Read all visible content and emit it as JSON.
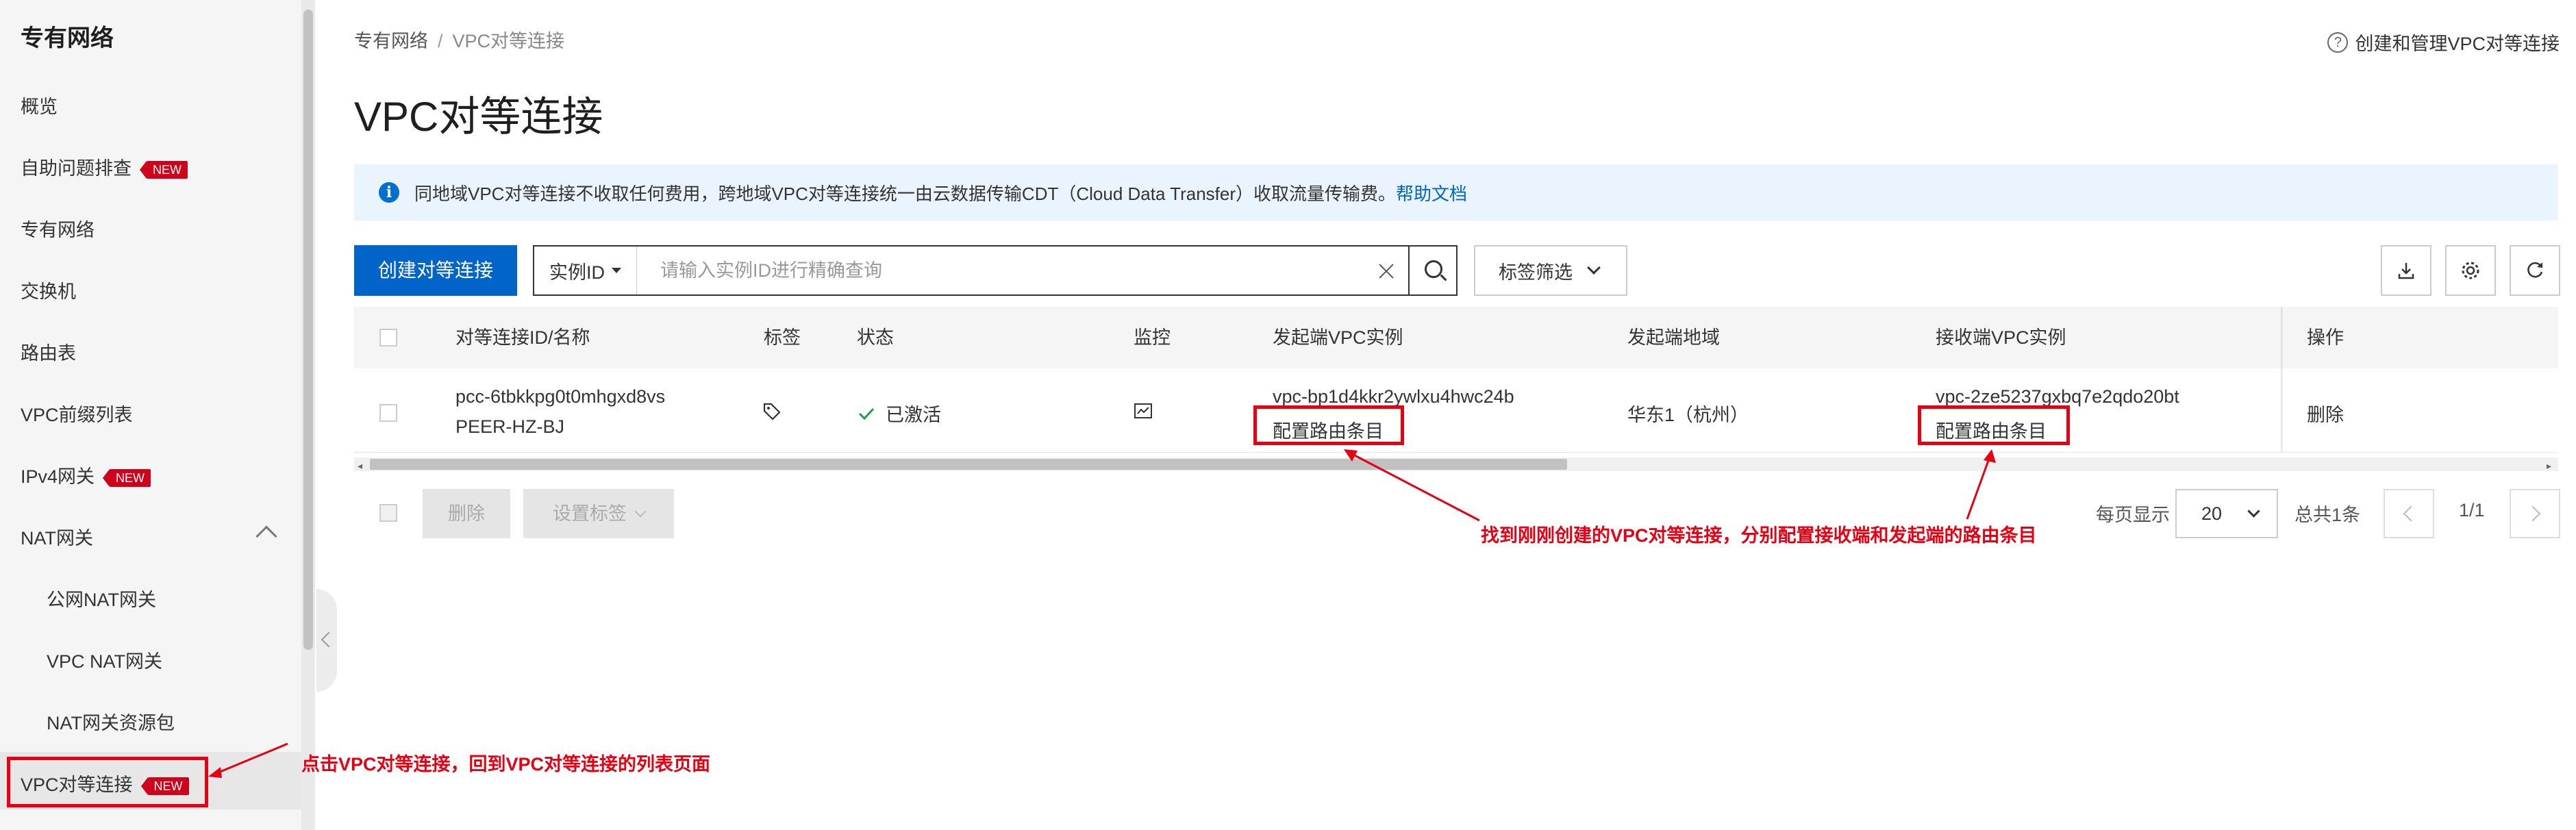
{
  "sidebar": {
    "title": "专有网络",
    "items": [
      {
        "label": "概览"
      },
      {
        "label": "自助问题排查",
        "badge": "NEW"
      },
      {
        "label": "专有网络"
      },
      {
        "label": "交换机"
      },
      {
        "label": "路由表"
      },
      {
        "label": "VPC前缀列表"
      },
      {
        "label": "IPv4网关",
        "badge": "NEW"
      },
      {
        "label": "NAT网关"
      },
      {
        "label": "公网NAT网关"
      },
      {
        "label": "VPC NAT网关"
      },
      {
        "label": "NAT网关资源包"
      },
      {
        "label": "VPC对等连接",
        "badge": "NEW"
      }
    ]
  },
  "breadcrumb": {
    "root": "专有网络",
    "separator": "/",
    "current": "VPC对等连接"
  },
  "help_link": "创建和管理VPC对等连接",
  "page_title": "VPC对等连接",
  "notice": {
    "text": "同地域VPC对等连接不收取任何费用，跨地域VPC对等连接统一由云数据传输CDT（Cloud Data Transfer）收取流量传输费。",
    "link": "帮助文档"
  },
  "toolbar": {
    "create_button": "创建对等连接",
    "search_field": "实例ID",
    "search_placeholder": "请输入实例ID进行精确查询",
    "tag_filter": "标签筛选"
  },
  "table": {
    "headers": [
      "对等连接ID/名称",
      "标签",
      "状态",
      "监控",
      "发起端VPC实例",
      "发起端地域",
      "接收端VPC实例",
      "操作"
    ],
    "rows": [
      {
        "id": "pcc-6tbkkpg0t0mhgxd8vs",
        "name": "PEER-HZ-BJ",
        "status": "已激活",
        "requester_vpc": "vpc-bp1d4kkr2ywlxu4hwc24b",
        "requester_route": "配置路由条目",
        "requester_region": "华东1（杭州）",
        "accepter_vpc": "vpc-2ze5237gxbq7e2qdo20bt",
        "accepter_route": "配置路由条目",
        "action": "删除"
      }
    ]
  },
  "footer": {
    "delete_button": "删除",
    "set_tag_button": "设置标签",
    "per_page_label": "每页显示",
    "per_page_value": "20",
    "total": "总共1条",
    "page_indicator": "1/1"
  },
  "annotations": {
    "sidebar_note": "点击VPC对等连接，回到VPC对等连接的列表页面",
    "route_note": "找到刚刚创建的VPC对等连接，分别配置接收端和发起端的路由条目",
    "color": "#e60012"
  },
  "colors": {
    "primary": "#0064c8",
    "success": "#1e9e4a",
    "badge": "#d0021b"
  }
}
